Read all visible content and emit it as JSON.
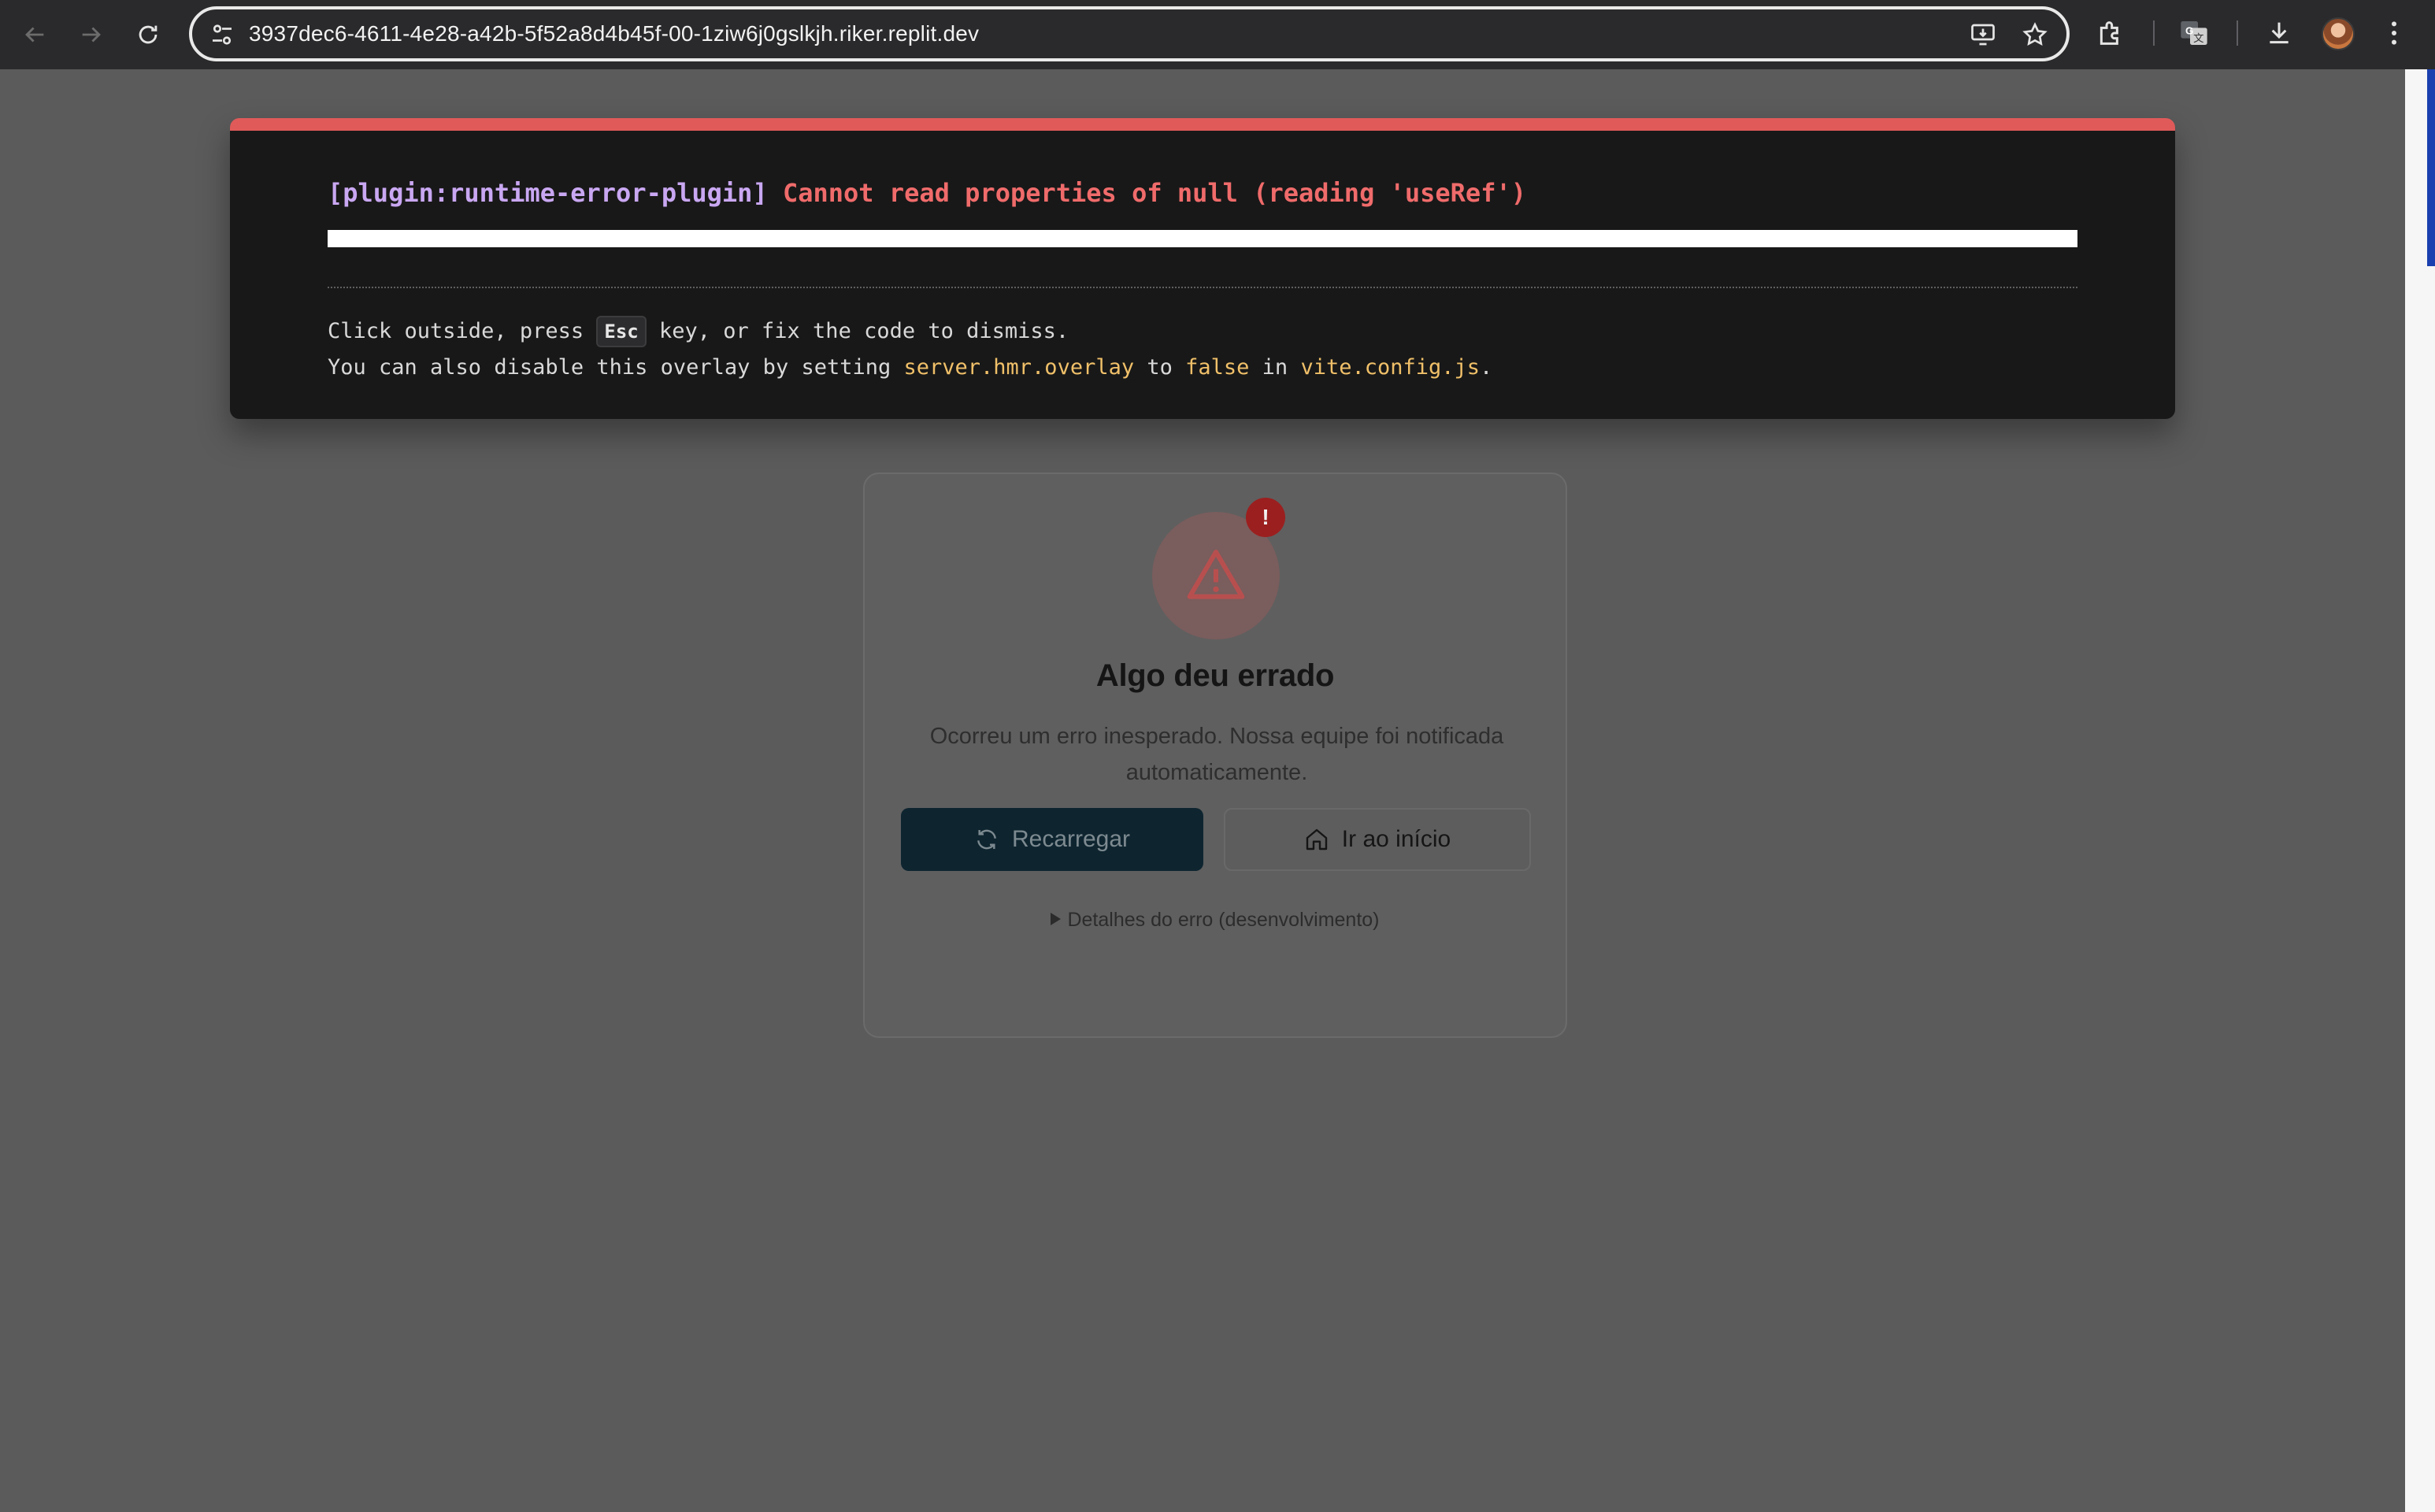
{
  "browser": {
    "url": "3937dec6-4611-4e28-a42b-5f52a8d4b45f-00-1ziw6j0gslkjh.riker.replit.dev",
    "icons": {
      "back": "arrow-left-icon",
      "forward": "arrow-right-icon",
      "reload": "reload-icon",
      "site_info": "tune-icon",
      "install": "install-app-icon",
      "bookmark": "star-icon",
      "extensions": "puzzle-icon",
      "translate": "translate-icon",
      "downloads": "download-icon",
      "menu": "kebab-menu-icon"
    }
  },
  "overlay": {
    "plugin": "[plugin:runtime-error-plugin]",
    "message": "Cannot read properties of null (reading 'useRef')",
    "tip_line1_a": "Click outside, press ",
    "tip_key": "Esc",
    "tip_line1_b": " key, or fix the code to dismiss.",
    "tip_line2_a": "You can also disable this overlay by setting ",
    "tip_code1": "server.hmr.overlay",
    "tip_line2_b": " to ",
    "tip_code2": "false",
    "tip_line2_c": " in ",
    "tip_code3": "vite.config.js",
    "tip_line2_d": ".",
    "colors": {
      "accent": "#e05a5a",
      "plugin": "#c9a7f2",
      "error": "#f06b6b",
      "code": "#f0c069"
    }
  },
  "error_page": {
    "badge": "!",
    "title": "Algo deu errado",
    "description": "Ocorreu um erro inesperado. Nossa equipe foi notificada automaticamente.",
    "reload_label": "Recarregar",
    "home_label": "Ir ao início",
    "details_label": "Detalhes do erro (desenvolvimento)"
  }
}
